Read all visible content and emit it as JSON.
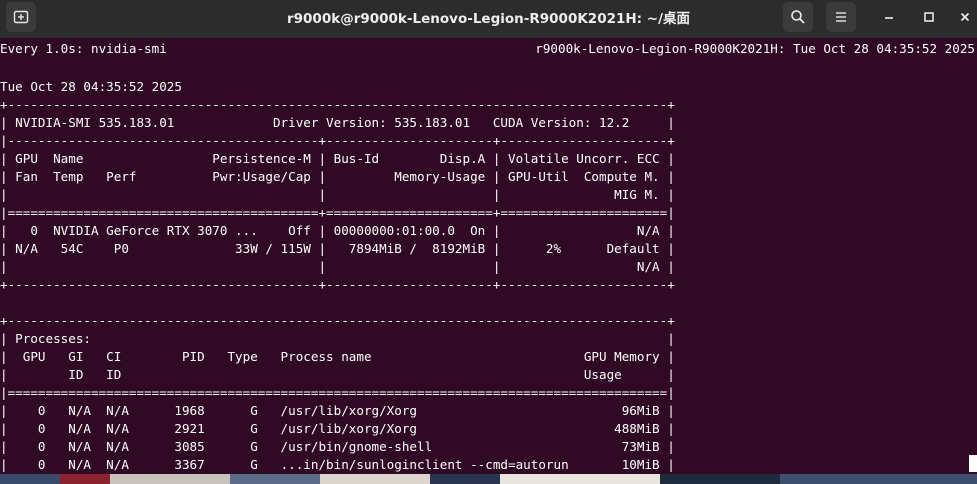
{
  "window": {
    "title": "r9000k@r9000k-Lenovo-Legion-R9000K2021H: ~/桌面"
  },
  "icons": {
    "new_tab": "new-tab-icon",
    "search": "search-icon",
    "menu": "hamburger-menu-icon",
    "minimize": "minimize-icon",
    "maximize": "maximize-icon",
    "close": "close-icon"
  },
  "colors": {
    "terminal_bg": "#300a24",
    "terminal_fg": "#ffffff",
    "titlebar_bg": "#2c2c2c"
  },
  "watch": {
    "header_left": "Every 1.0s: nvidia-smi",
    "header_right": "r9000k-Lenovo-Legion-R9000K2021H: Tue Oct 28 04:35:52 2025"
  },
  "smi": {
    "date": "Tue Oct 28 04:35:52 2025",
    "border_top": "+---------------------------------------------------------------------------------------+",
    "version_line": "| NVIDIA-SMI 535.183.01             Driver Version: 535.183.01   CUDA Version: 12.2     |",
    "sep_a": "|-----------------------------------------+----------------------+----------------------+",
    "gpu_header": [
      "| GPU  Name                 Persistence-M | Bus-Id        Disp.A | Volatile Uncorr. ECC |",
      "| Fan  Temp   Perf          Pwr:Usage/Cap |         Memory-Usage | GPU-Util  Compute M. |",
      "|                                         |                      |               MIG M. |"
    ],
    "sep_eq": "|=========================================+======================+======================|",
    "gpu_rows": [
      "|   0  NVIDIA GeForce RTX 3070 ...    Off | 00000000:01:00.0  On |                  N/A |",
      "| N/A   54C    P0              33W / 115W |   7894MiB /  8192MiB |      2%      Default |",
      "|                                         |                      |                  N/A |"
    ],
    "border_gpu_bottom": "+-----------------------------------------+----------------------+----------------------+",
    "proc_top": "+---------------------------------------------------------------------------------------+",
    "proc_header": [
      "| Processes:                                                                            |",
      "|  GPU   GI   CI        PID   Type   Process name                            GPU Memory |",
      "|        ID   ID                                                             Usage      |"
    ],
    "proc_sep": "|=======================================================================================|",
    "proc_rows": [
      "|    0   N/A  N/A      1968      G   /usr/lib/xorg/Xorg                           96MiB |",
      "|    0   N/A  N/A      2921      G   /usr/lib/xorg/Xorg                          488MiB |",
      "|    0   N/A  N/A      3085      G   /usr/bin/gnome-shell                         73MiB |",
      "|    0   N/A  N/A      3367      G   ...in/bin/sunloginclient --cmd=autorun       10MiB |"
    ]
  }
}
